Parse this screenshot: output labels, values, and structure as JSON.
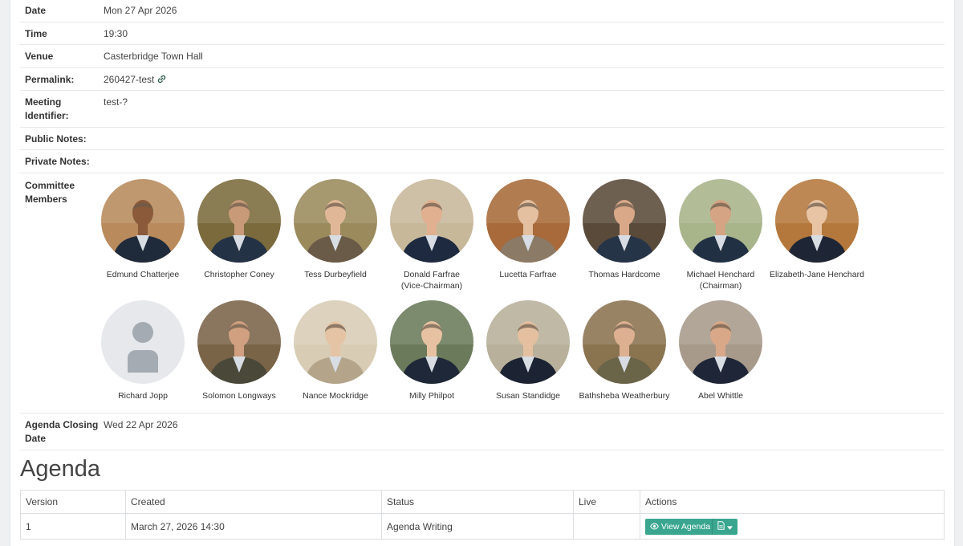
{
  "details": {
    "date_label": "Date",
    "date_value": "Mon 27 Apr 2026",
    "time_label": "Time",
    "time_value": "19:30",
    "venue_label": "Venue",
    "venue_value": "Casterbridge Town Hall",
    "permalink_label": "Permalink:",
    "permalink_value": "260427-test",
    "meeting_id_label_1": "Meeting",
    "meeting_id_label_2": "Identifier:",
    "meeting_id_value": "test-?",
    "public_notes_label": "Public Notes:",
    "private_notes_label": "Private Notes:",
    "committee_label_1": "Committee",
    "committee_label_2": "Members",
    "closing_label_1": "Agenda Closing",
    "closing_label_2": "Date",
    "closing_value": "Wed 22 Apr 2026"
  },
  "members": [
    {
      "name": "Edmund Chatterjee",
      "role": "",
      "bg": "#b88a5c",
      "skin": "#8a5a3a",
      "suit": "#1f2a3a"
    },
    {
      "name": "Christopher Coney",
      "role": "",
      "bg": "#7a6a3c",
      "skin": "#c89a78",
      "suit": "#243246"
    },
    {
      "name": "Tess Durbeyfield",
      "role": "",
      "bg": "#9a8a5c",
      "skin": "#e0b898",
      "suit": "#6a5a48"
    },
    {
      "name": "Donald Farfrae",
      "role": "(Vice-Chairman)",
      "bg": "#c8b89a",
      "skin": "#e0b090",
      "suit": "#1d2a40"
    },
    {
      "name": "Lucetta Farfrae",
      "role": "",
      "bg": "#a86a3a",
      "skin": "#e4c0a0",
      "suit": "#8a7a66"
    },
    {
      "name": "Thomas Hardcome",
      "role": "",
      "bg": "#5a4a3a",
      "skin": "#d8a888",
      "suit": "#263448"
    },
    {
      "name": "Michael Henchard",
      "role": "(Chairman)",
      "bg": "#a8b48a",
      "skin": "#d4a484",
      "suit": "#223044"
    },
    {
      "name": "Elizabeth-Jane Henchard",
      "role": "",
      "bg": "#b4783c",
      "skin": "#e8c4a4",
      "suit": "#1e2636"
    },
    {
      "name": "Richard Jopp",
      "role": "",
      "placeholder": true,
      "bg": "#e6e8ec",
      "skin": "#a4abb3",
      "suit": "#a4abb3"
    },
    {
      "name": "Solomon Longways",
      "role": "",
      "bg": "#7a6448",
      "skin": "#d0a080",
      "suit": "#4a4838"
    },
    {
      "name": "Nance Mockridge",
      "role": "",
      "bg": "#d8ccb4",
      "skin": "#e4c4a4",
      "suit": "#b4a48a"
    },
    {
      "name": "Milly Philpot",
      "role": "",
      "bg": "#6a7a5a",
      "skin": "#e6c2a2",
      "suit": "#1e2838"
    },
    {
      "name": "Susan Standidge",
      "role": "",
      "bg": "#b8b09a",
      "skin": "#e4c0a0",
      "suit": "#1c2434"
    },
    {
      "name": "Bathsheba Weatherbury",
      "role": "",
      "bg": "#8a7450",
      "skin": "#dcb090",
      "suit": "#6a6448"
    },
    {
      "name": "Abel Whittle",
      "role": "",
      "bg": "#a89a8a",
      "skin": "#d8a888",
      "suit": "#1e2638"
    }
  ],
  "agenda": {
    "title": "Agenda",
    "headers": [
      "Version",
      "Created",
      "Status",
      "Live",
      "Actions"
    ],
    "rows": [
      {
        "version": "1",
        "created": "March 27, 2026 14:30",
        "status": "Agenda Writing",
        "live": ""
      }
    ],
    "view_button_label": "View Agenda",
    "accent_color": "#3aa68f"
  },
  "icons": {
    "permalink": "link-icon",
    "view": "eye-icon",
    "document": "document-icon",
    "dropdown": "caret-down-icon",
    "placeholder_avatar": "user-silhouette-icon"
  }
}
